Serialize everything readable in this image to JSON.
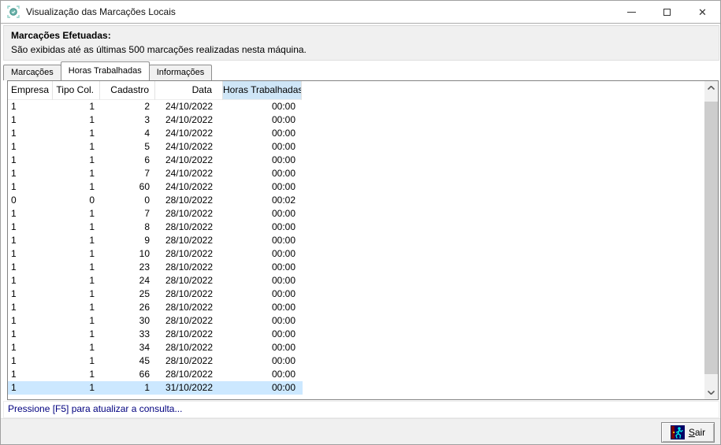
{
  "window": {
    "title": "Visualização das Marcações Locais",
    "icons": {
      "titlebar": [
        "app-icon",
        "minimize-icon",
        "maximize-icon",
        "close-icon"
      ],
      "scrollbar": [
        "chevron-up-icon",
        "chevron-down-icon"
      ],
      "exit_button_icon": "exit-door-running-icon"
    }
  },
  "header": {
    "title": "Marcações Efetuadas:",
    "subtitle": "São exibidas até as últimas 500 marcações realizadas nesta máquina."
  },
  "tabs": [
    {
      "label": "Marcações",
      "active": false
    },
    {
      "label": "Horas Trabalhadas",
      "active": true
    },
    {
      "label": "Informações",
      "active": false
    }
  ],
  "table": {
    "columns": [
      {
        "label": "Empresa",
        "align": "left"
      },
      {
        "label": "Tipo Col.",
        "align": "right"
      },
      {
        "label": "Cadastro",
        "align": "right"
      },
      {
        "label": "Data",
        "align": "right"
      },
      {
        "label": "Horas Trabalhadas",
        "align": "center",
        "highlighted": true
      }
    ],
    "rows": [
      [
        "1",
        "1",
        "2",
        "24/10/2022",
        "00:00"
      ],
      [
        "1",
        "1",
        "3",
        "24/10/2022",
        "00:00"
      ],
      [
        "1",
        "1",
        "4",
        "24/10/2022",
        "00:00"
      ],
      [
        "1",
        "1",
        "5",
        "24/10/2022",
        "00:00"
      ],
      [
        "1",
        "1",
        "6",
        "24/10/2022",
        "00:00"
      ],
      [
        "1",
        "1",
        "7",
        "24/10/2022",
        "00:00"
      ],
      [
        "1",
        "1",
        "60",
        "24/10/2022",
        "00:00"
      ],
      [
        "0",
        "0",
        "0",
        "28/10/2022",
        "00:02"
      ],
      [
        "1",
        "1",
        "7",
        "28/10/2022",
        "00:00"
      ],
      [
        "1",
        "1",
        "8",
        "28/10/2022",
        "00:00"
      ],
      [
        "1",
        "1",
        "9",
        "28/10/2022",
        "00:00"
      ],
      [
        "1",
        "1",
        "10",
        "28/10/2022",
        "00:00"
      ],
      [
        "1",
        "1",
        "23",
        "28/10/2022",
        "00:00"
      ],
      [
        "1",
        "1",
        "24",
        "28/10/2022",
        "00:00"
      ],
      [
        "1",
        "1",
        "25",
        "28/10/2022",
        "00:00"
      ],
      [
        "1",
        "1",
        "26",
        "28/10/2022",
        "00:00"
      ],
      [
        "1",
        "1",
        "30",
        "28/10/2022",
        "00:00"
      ],
      [
        "1",
        "1",
        "33",
        "28/10/2022",
        "00:00"
      ],
      [
        "1",
        "1",
        "34",
        "28/10/2022",
        "00:00"
      ],
      [
        "1",
        "1",
        "45",
        "28/10/2022",
        "00:00"
      ],
      [
        "1",
        "1",
        "66",
        "28/10/2022",
        "00:00"
      ],
      [
        "1",
        "1",
        "1",
        "31/10/2022",
        "00:00"
      ]
    ],
    "selected_row_index": 21
  },
  "status_bar": {
    "text": "Pressione [F5] para atualizar a consulta..."
  },
  "footer": {
    "exit_button": {
      "accelerator": "S",
      "label_rest": "air",
      "full_label": "Sair"
    }
  },
  "colors": {
    "header_column_highlight": "#cfe6f7",
    "selected_row_highlight": "#cce8ff",
    "status_text": "#00007f",
    "panel_gray": "#f0f0f0"
  }
}
